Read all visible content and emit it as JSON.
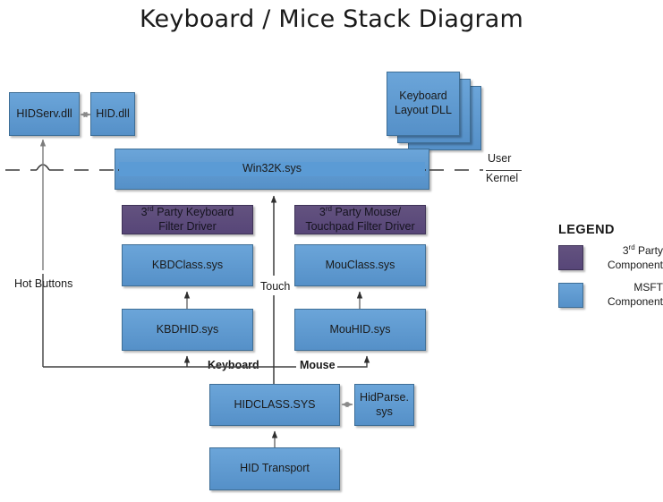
{
  "title": "Keyboard / Mice Stack Diagram",
  "colors": {
    "msft": "#5B9BD5",
    "third_party": "#5B4A7F",
    "line": "#404040",
    "background": "#FFFFFF"
  },
  "boxes": {
    "hidserv": "HIDServ.dll",
    "hiddll": "HID.dll",
    "keyboard_layout_dll": "Keyboard Layout DLL",
    "win32k": "Win32K.sys",
    "kbd_filter_line1": "3",
    "kbd_filter_sup": "rd",
    "kbd_filter_line1b": " Party Keyboard",
    "kbd_filter_line2": "Filter Driver",
    "mou_filter_line1": "3",
    "mou_filter_sup": "rd",
    "mou_filter_line1b": " Party Mouse/",
    "mou_filter_line2": "Touchpad Filter Driver",
    "kbdclass": "KBDClass.sys",
    "mouclass": "MouClass.sys",
    "kbdhid": "KBDHID.sys",
    "mouhid": "MouHID.sys",
    "hidclass": "HIDCLASS.SYS",
    "hidparse": "HidParse. sys",
    "hidparse_line1": "HidParse.",
    "hidparse_line2": "sys",
    "hid_transport": "HID Transport"
  },
  "edge_labels": {
    "hot_buttons": "Hot Buttons",
    "touch": "Touch",
    "keyboard": "Keyboard",
    "mouse": "Mouse"
  },
  "boundary": {
    "user": "User",
    "kernel": "Kernel"
  },
  "legend": {
    "title": "LEGEND",
    "items": [
      {
        "swatch": "third_party",
        "line1": "3",
        "sup": "rd",
        "line1b": " Party",
        "line2": "Component"
      },
      {
        "swatch": "msft",
        "line1": "MSFT",
        "line2": "Component"
      }
    ]
  }
}
